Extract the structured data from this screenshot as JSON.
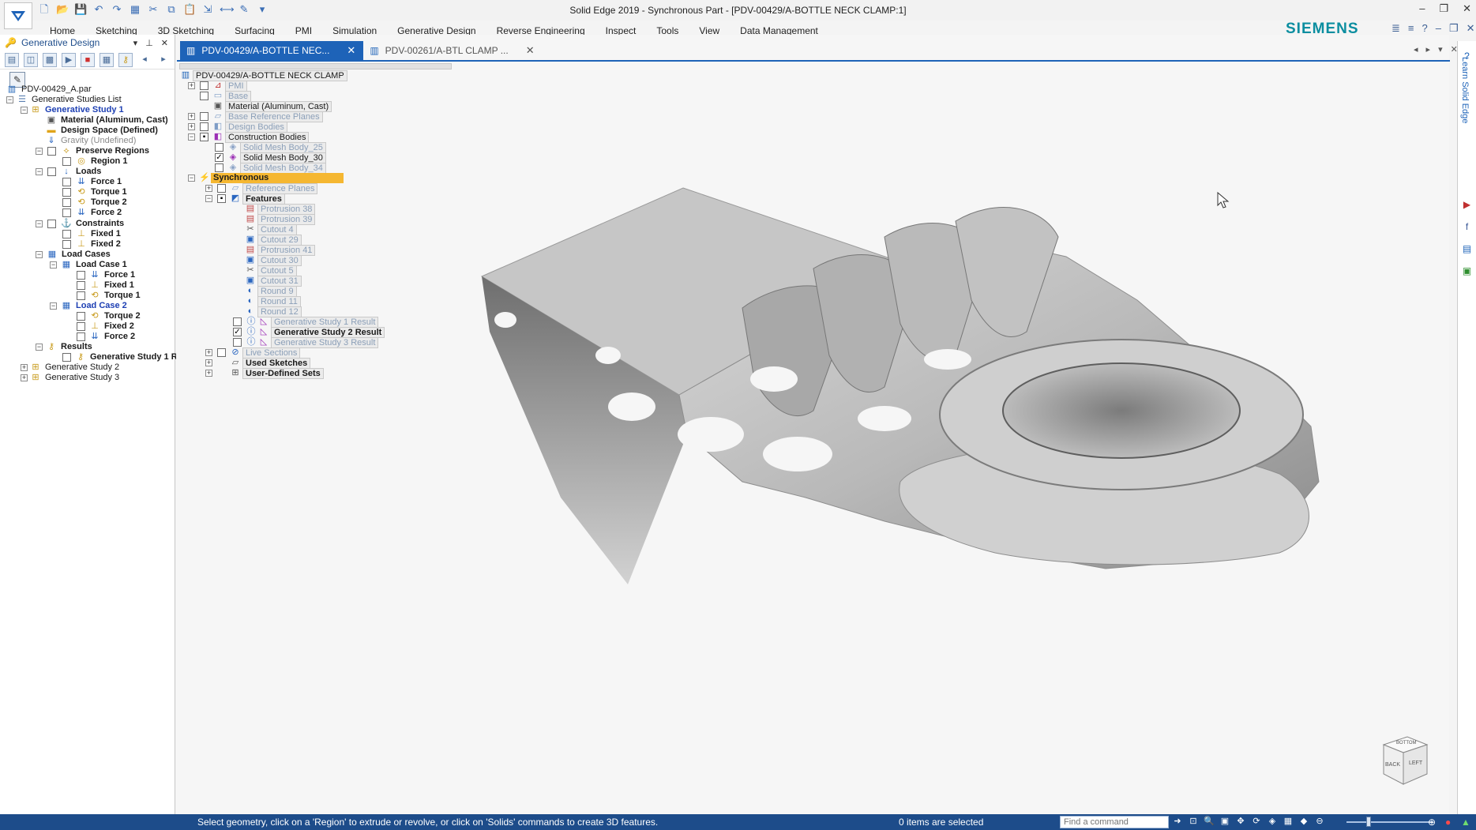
{
  "window": {
    "title": "Solid Edge 2019 - Synchronous Part - [PDV-00429/A-BOTTLE NECK CLAMP:1]",
    "brand": "SIEMENS"
  },
  "menu": [
    "Home",
    "Sketching",
    "3D Sketching",
    "Surfacing",
    "PMI",
    "Simulation",
    "Generative Design",
    "Reverse Engineering",
    "Inspect",
    "Tools",
    "View",
    "Data Management"
  ],
  "left_panel": {
    "title": "Generative Design",
    "tree": [
      {
        "label": "PDV-00429_A.par",
        "level": 0
      },
      {
        "label": "Generative Studies List",
        "level": 1
      },
      {
        "label": "Generative Study 1",
        "level": 2
      },
      {
        "label": "Material (Aluminum, Cast)",
        "level": 3
      },
      {
        "label": "Design Space (Defined)",
        "level": 3
      },
      {
        "label": "Gravity (Undefined)",
        "level": 3
      },
      {
        "label": "Preserve Regions",
        "level": 3
      },
      {
        "label": "Region 1",
        "level": 4
      },
      {
        "label": "Loads",
        "level": 3
      },
      {
        "label": "Force 1",
        "level": 4
      },
      {
        "label": "Torque 1",
        "level": 4
      },
      {
        "label": "Torque 2",
        "level": 4
      },
      {
        "label": "Force 2",
        "level": 4
      },
      {
        "label": "Constraints",
        "level": 3
      },
      {
        "label": "Fixed 1",
        "level": 4
      },
      {
        "label": "Fixed 2",
        "level": 4
      },
      {
        "label": "Load Cases",
        "level": 3
      },
      {
        "label": "Load Case 1",
        "level": 4
      },
      {
        "label": "Force 1",
        "level": 5
      },
      {
        "label": "Fixed 1",
        "level": 5
      },
      {
        "label": "Torque 1",
        "level": 5
      },
      {
        "label": "Load Case 2",
        "level": 4
      },
      {
        "label": "Torque 2",
        "level": 5
      },
      {
        "label": "Fixed 2",
        "level": 5
      },
      {
        "label": "Force 2",
        "level": 5
      },
      {
        "label": "Results",
        "level": 3
      },
      {
        "label": "Generative Study 1 R",
        "level": 4
      },
      {
        "label": "Generative Study 2",
        "level": 2
      },
      {
        "label": "Generative Study 3",
        "level": 2
      }
    ]
  },
  "tabs": [
    {
      "label": "PDV-00429/A-BOTTLE NEC...",
      "active": true
    },
    {
      "label": "PDV-00261/A-BTL CLAMP ...",
      "active": false
    }
  ],
  "pathfinder": {
    "root": "PDV-00429/A-BOTTLE NECK CLAMP",
    "items": [
      {
        "label": "PMI"
      },
      {
        "label": "Base"
      },
      {
        "label": "Material (Aluminum, Cast)"
      },
      {
        "label": "Base Reference Planes"
      },
      {
        "label": "Design Bodies"
      },
      {
        "label": "Construction Bodies"
      },
      {
        "label": "Solid Mesh Body_25"
      },
      {
        "label": "Solid Mesh Body_30"
      },
      {
        "label": "Solid Mesh Body_34"
      },
      {
        "label": "Synchronous"
      },
      {
        "label": "Reference Planes"
      },
      {
        "label": "Features"
      },
      {
        "label": "Protrusion 38"
      },
      {
        "label": "Protrusion 39"
      },
      {
        "label": "Cutout 4"
      },
      {
        "label": "Cutout 29"
      },
      {
        "label": "Protrusion 41"
      },
      {
        "label": "Cutout 30"
      },
      {
        "label": "Cutout 5"
      },
      {
        "label": "Cutout 31"
      },
      {
        "label": "Round 9"
      },
      {
        "label": "Round 11"
      },
      {
        "label": "Round 12"
      },
      {
        "label": "Generative Study 1 Result"
      },
      {
        "label": "Generative Study 2 Result"
      },
      {
        "label": "Generative Study 3 Result"
      },
      {
        "label": "Live Sections"
      },
      {
        "label": "Used Sketches"
      },
      {
        "label": "User-Defined Sets"
      }
    ]
  },
  "right_bar": {
    "label": "Learn Solid Edge"
  },
  "view_cube": {
    "faces": [
      "BACK",
      "LEFT",
      "BOTTOM"
    ]
  },
  "status": {
    "message": "Select geometry, click on a 'Region' to extrude or revolve, or click on 'Solids' commands to create 3D features.",
    "selection": "0 items are selected",
    "find_placeholder": "Find a command"
  },
  "colors": {
    "accent": "#1e63b8",
    "status_bar": "#1d4c8a",
    "brand": "#0b8ea0",
    "synchronous_highlight": "#f5b731"
  }
}
